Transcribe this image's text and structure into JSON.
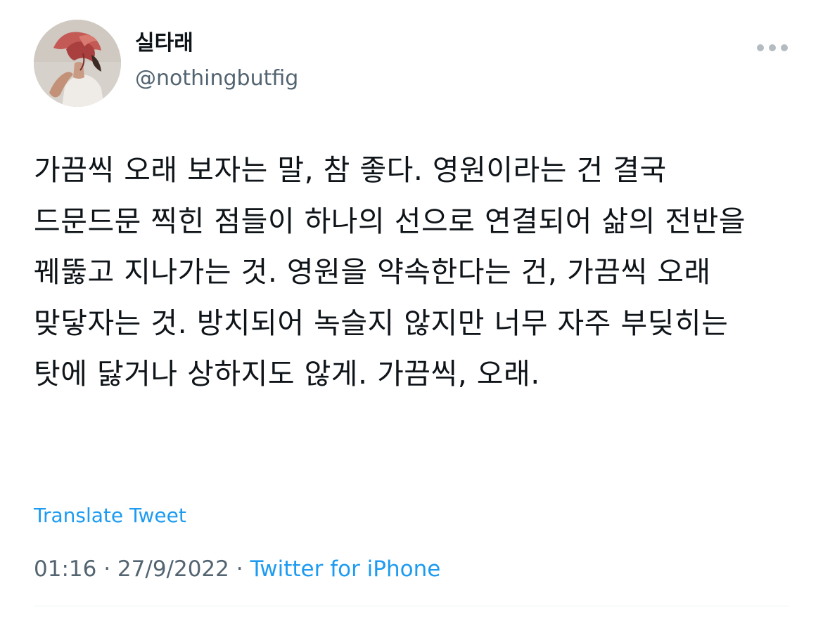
{
  "user": {
    "display_name": "실타래",
    "handle": "@nothingbutfig"
  },
  "more_icon": "more-horizontal-icon",
  "tweet": {
    "text": "가끔씩 오래 보자는 말, 참 좋다. 영원이라는 건 결국 드문드문 찍힌 점들이 하나의 선으로 연결되어 삶의 전반을 꿰뚫고 지나가는 것. 영원을 약속한다는 건, 가끔씩 오래 맞닿자는 것. 방치되어 녹슬지 않지만 너무 자주 부딪히는 탓에 닳거나 상하지도 않게. 가끔씩, 오래."
  },
  "translate_label": "Translate Tweet",
  "meta": {
    "time": "01:16",
    "separator": "·",
    "date": "27/9/2022",
    "source": "Twitter for iPhone"
  },
  "colors": {
    "text": "#0f1419",
    "secondary": "#536471",
    "link": "#1d9bf0"
  }
}
